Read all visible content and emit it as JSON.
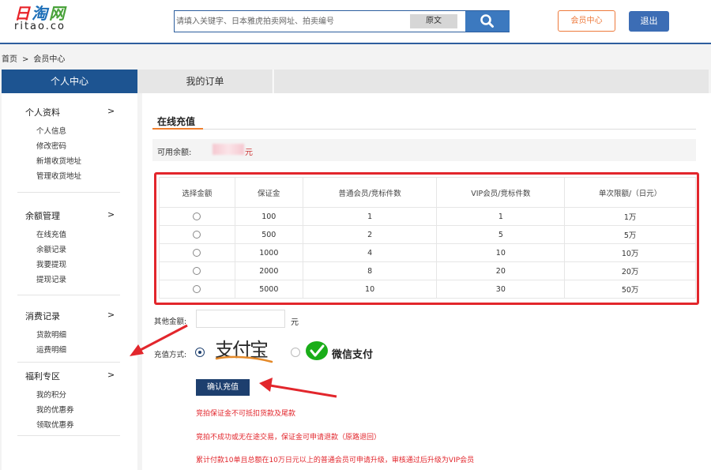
{
  "logo": {
    "cn_1": "日",
    "cn_2": "淘",
    "cn_3": "网",
    "en": "ritao.co"
  },
  "header": {
    "search_placeholder": "请填入关键字、日本雅虎拍卖网址、拍卖编号",
    "original_text_button": "原文",
    "member_center_button": "会员中心",
    "logout_button": "退出"
  },
  "breadcrumb": {
    "home": "首页",
    "separator": ">",
    "current": "会员中心"
  },
  "tabs": {
    "personal": "个人中心",
    "orders": "我的订单"
  },
  "sidebar": {
    "groups": [
      {
        "title": "个人资料",
        "arrow": ">",
        "items": [
          "个人信息",
          "修改密码",
          "新增收货地址",
          "管理收货地址"
        ]
      },
      {
        "title": "余额管理",
        "arrow": ">",
        "items": [
          "在线充值",
          "余额记录",
          "我要提现",
          "提现记录"
        ]
      },
      {
        "title": "消费记录",
        "arrow": ">",
        "items": [
          "货款明细",
          "运费明细"
        ]
      },
      {
        "title": "福利专区",
        "arrow": ">",
        "items": [
          "我的积分",
          "我的优惠券",
          "领取优惠券"
        ]
      }
    ]
  },
  "main": {
    "title": "在线充值",
    "balance_label": "可用余额:",
    "balance_unit": "元",
    "table": {
      "headers": [
        "选择金额",
        "保证金",
        "普通会员/竞标件数",
        "VIP会员/竞标件数",
        "单次限额/（日元）"
      ],
      "rows": [
        [
          "",
          "100",
          "1",
          "1",
          "1万"
        ],
        [
          "",
          "500",
          "2",
          "5",
          "5万"
        ],
        [
          "",
          "1000",
          "4",
          "10",
          "10万"
        ],
        [
          "",
          "2000",
          "8",
          "20",
          "20万"
        ],
        [
          "",
          "5000",
          "10",
          "30",
          "50万"
        ]
      ]
    },
    "other_amount_label": "其他金额:",
    "other_amount_value": "",
    "other_amount_unit": "元",
    "payment_label": "充值方式:",
    "alipay_label": "支付宝",
    "wechat_label": "微信支付",
    "confirm_button": "确认充值",
    "notices": [
      "竞拍保证金不可抵扣货款及尾款",
      "竞拍不成功或无在途交易，保证金可申请退款（原路退回）",
      "累计付款10单且总额在10万日元以上的普通会员可申请升级，审核通过后升级为VIP会员"
    ]
  },
  "colors": {
    "brand_blue": "#1d5491",
    "accent_orange": "#f07f2e",
    "highlight_red": "#e2262c",
    "wechat_green": "#1aad19"
  },
  "icons": {
    "search": "search-icon",
    "wechat": "wechat-icon",
    "alipay": "alipay-logo"
  }
}
